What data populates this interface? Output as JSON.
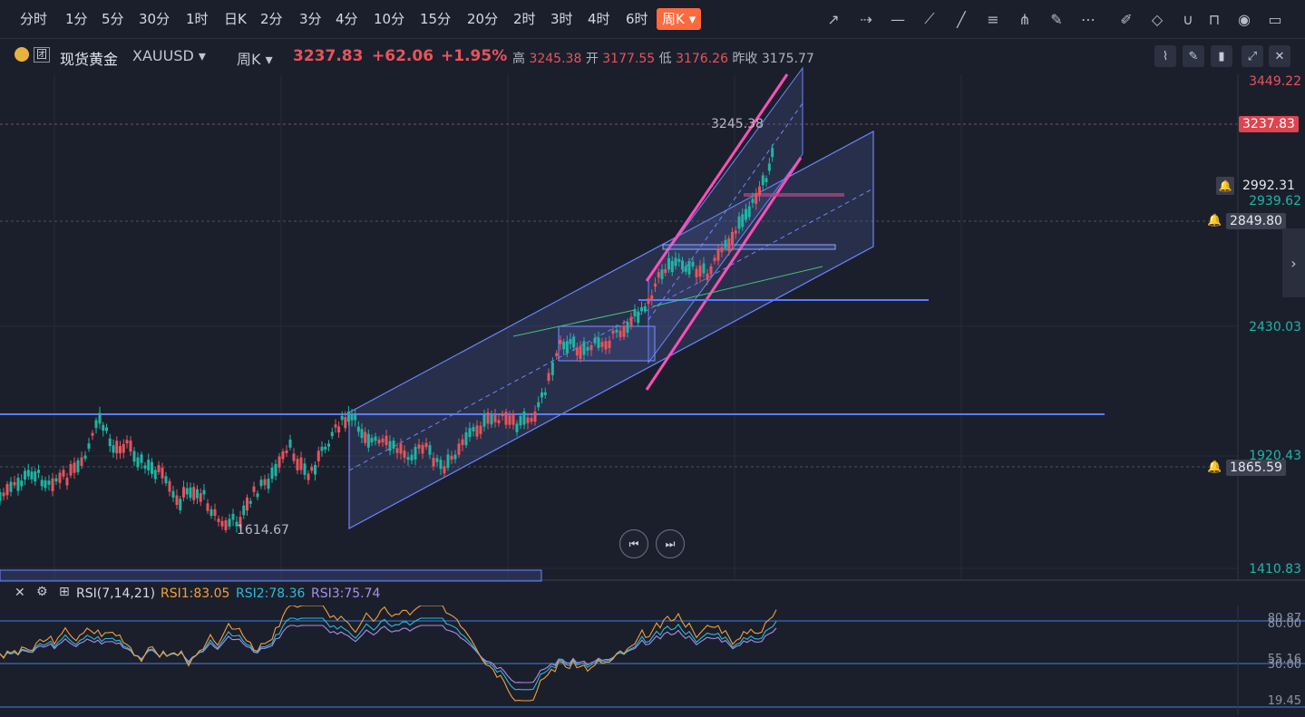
{
  "timeframes": [
    "分时",
    "1分",
    "5分",
    "30分",
    "1时",
    "日K",
    "2分",
    "3分",
    "4分",
    "10分",
    "15分",
    "20分",
    "2时",
    "3时",
    "4时",
    "6时"
  ],
  "active_timeframe": "周K",
  "symbol": {
    "name": "现货黄金",
    "code": "XAUUSD",
    "tag": "团",
    "period": "周K",
    "last": "3237.83",
    "change": "+62.06",
    "change_pct": "+1.95%",
    "high_label": "高",
    "high": "3245.38",
    "open_label": "开",
    "open": "3177.55",
    "low_label": "低",
    "low": "3176.26",
    "prev_label": "昨收",
    "prev": "3175.77"
  },
  "price_axis": {
    "labels": [
      "3449.22",
      "2939.62",
      "2430.03",
      "1920.43",
      "1410.83"
    ],
    "last_tag": "3237.83",
    "alert_tags": [
      "2992.31",
      "2849.80",
      "1865.59"
    ]
  },
  "annotations": {
    "high_mark": "3245.38",
    "low_mark": "1614.67"
  },
  "rsi": {
    "title": "RSI(7,14,21)",
    "rsi1": "RSI1:83.05",
    "rsi2": "RSI2:78.36",
    "rsi3": "RSI3:75.74",
    "axis_labels": [
      "80.87",
      "80.00",
      "55.16",
      "30.00",
      "19.45"
    ]
  },
  "colors": {
    "up": "#e8535b",
    "down": "#1fb5a3",
    "channel": "#6b86ff",
    "trend_pink": "#ff4fb8",
    "accent": "#ff6a3d"
  }
}
